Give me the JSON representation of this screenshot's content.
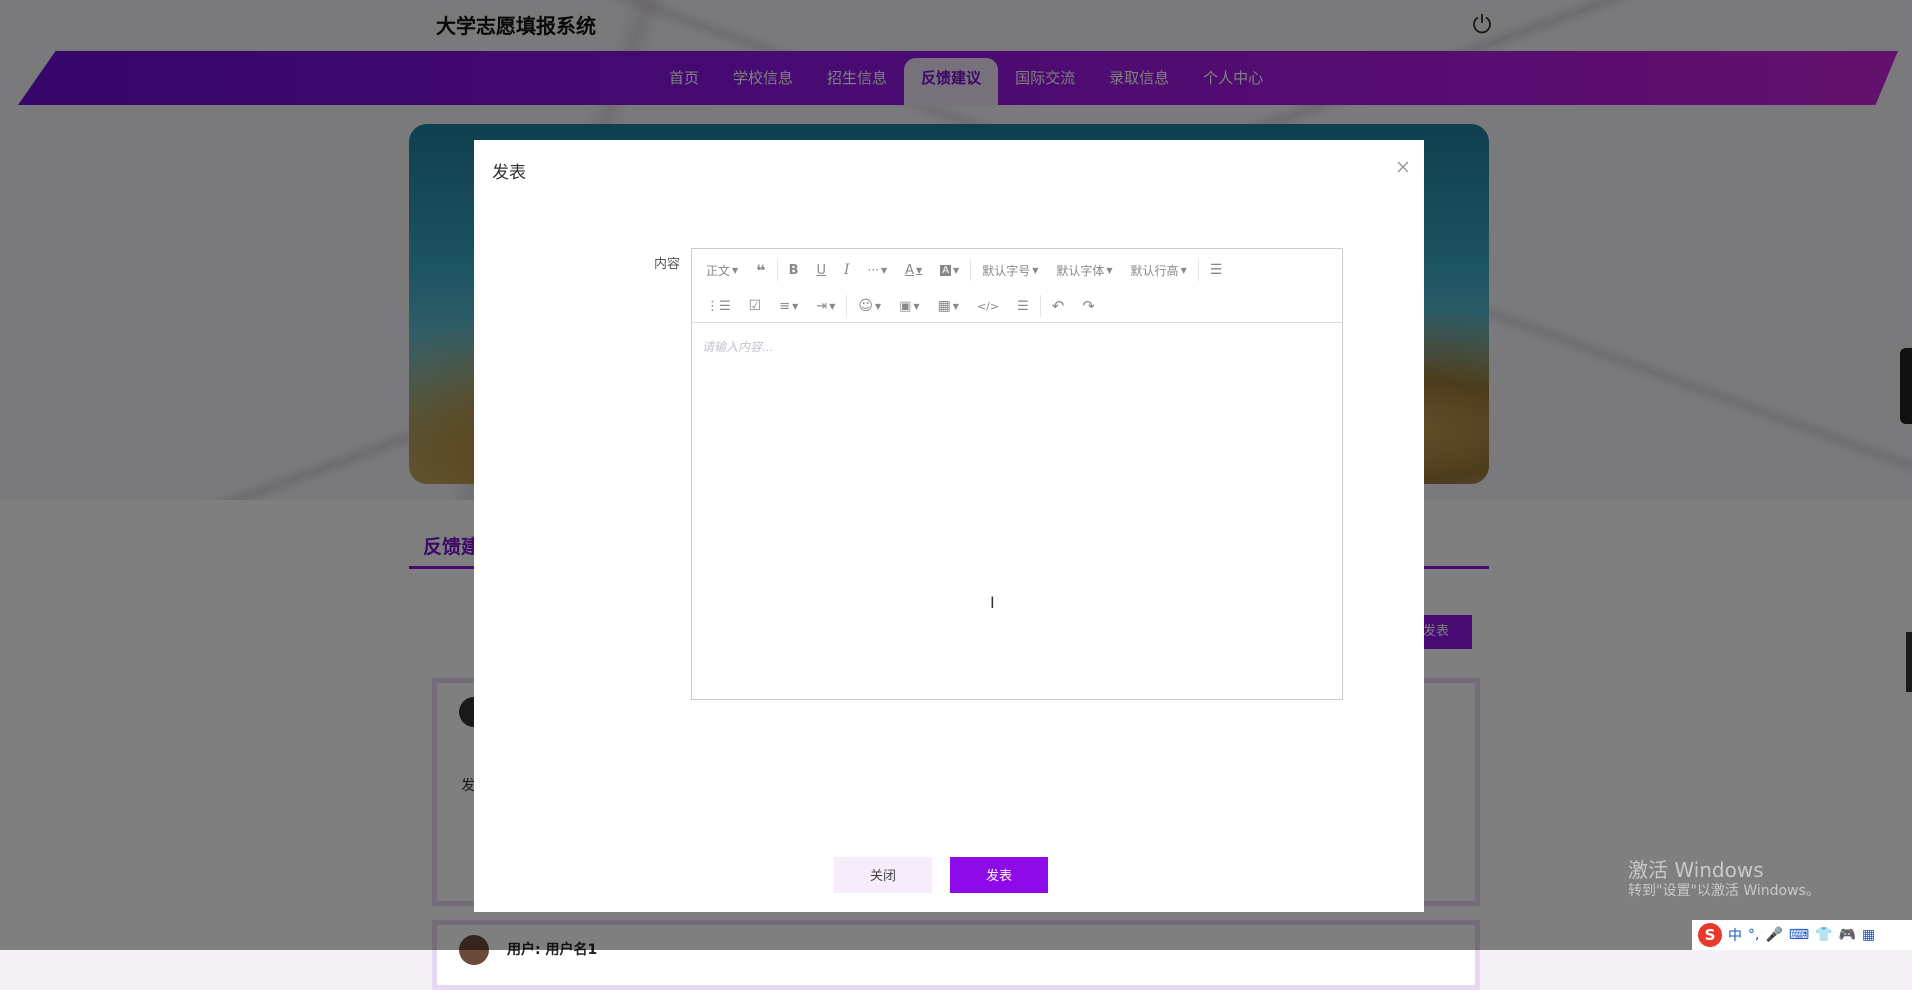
{
  "site": {
    "title": "大学志愿填报系统"
  },
  "nav": {
    "items": [
      {
        "label": "首页",
        "active": false
      },
      {
        "label": "学校信息",
        "active": false
      },
      {
        "label": "招生信息",
        "active": false
      },
      {
        "label": "反馈建议",
        "active": true
      },
      {
        "label": "国际交流",
        "active": false
      },
      {
        "label": "录取信息",
        "active": false
      },
      {
        "label": "个人中心",
        "active": false
      }
    ]
  },
  "background": {
    "section_title": "反馈建",
    "post_button": "发表",
    "card1_text": "发",
    "card2_user": "用户: 用户名1"
  },
  "modal": {
    "title": "发表",
    "field_label": "内容",
    "placeholder": "请输入内容...",
    "toolbar": {
      "paragraph": "正文",
      "font_size": "默认字号",
      "font_family": "默认字体",
      "line_height": "默认行高"
    },
    "close_button": "关闭",
    "publish_button": "发表"
  },
  "os": {
    "watermark_title": "激活 Windows",
    "watermark_sub": "转到\"设置\"以激活 Windows。",
    "ime_label": "中"
  },
  "colors": {
    "accent": "#8e16e6",
    "publish_button": "#8e0ae8",
    "close_button_bg": "#f7ecfb"
  }
}
